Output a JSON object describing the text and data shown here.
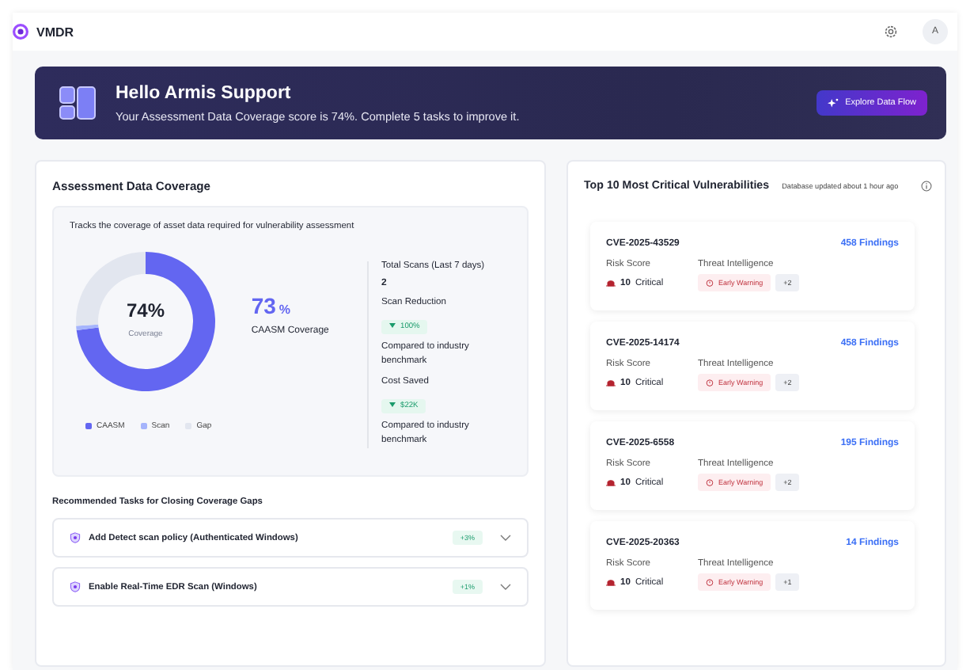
{
  "app": {
    "title": "VMDR",
    "avatar": "A"
  },
  "banner": {
    "heading": "Hello Armis Support",
    "text": "Your Assessment Data Coverage score is 74%. Complete 5 tasks to improve it.",
    "button": "Explore Data Flow"
  },
  "coverage": {
    "title": "Assessment Data Coverage",
    "description": "Tracks the coverage of asset data required for vulnerability assessment",
    "center_value": "74%",
    "center_label": "Coverage",
    "caasm_value": "73",
    "caasm_unit": "%",
    "caasm_label": "CAASM Coverage",
    "chart_data": {
      "type": "donut",
      "categories": [
        "CAASM",
        "Scan",
        "Gap"
      ],
      "series": [
        {
          "values": [
            73,
            1,
            26
          ]
        }
      ],
      "colors": [
        "#6366f1",
        "#a5b4fc",
        "#e2e6ef"
      ]
    },
    "stats": [
      {
        "label": "Total Scans (Last 7 days)",
        "value": "2"
      },
      {
        "label": "Scan Reduction",
        "badge": "100%",
        "note": "Compared to industry benchmark"
      },
      {
        "label": "Cost Saved",
        "badge": "$22K",
        "note": "Compared to industry benchmark"
      }
    ],
    "tasks_title": "Recommended Tasks for Closing Coverage Gaps",
    "tasks": [
      {
        "label": "Add Detect scan policy (Authenticated Windows)",
        "gain": "+3%",
        "expanded": false
      },
      {
        "label": "Enable Real-Time EDR Scan (Windows)",
        "gain": "+1%",
        "expanded": false
      }
    ]
  },
  "vulnerabilities": {
    "title": "Top 10 Most Critical Vulnerabilities",
    "updated": "Database updated about 1 hour ago",
    "items": [
      {
        "id": "CVE-2025-43529",
        "findings": "458 Findings",
        "risk_label": "Risk Score",
        "score": "10",
        "severity": "Critical",
        "intel_label": "Threat Intelligence",
        "tag": "Early Warning",
        "more": "+2"
      },
      {
        "id": "CVE-2025-14174",
        "findings": "458 Findings",
        "risk_label": "Risk Score",
        "score": "10",
        "severity": "Critical",
        "intel_label": "Threat Intelligence",
        "tag": "Early Warning",
        "more": "+2"
      },
      {
        "id": "CVE-2025-6558",
        "findings": "195 Findings",
        "risk_label": "Risk Score",
        "score": "10",
        "severity": "Critical",
        "intel_label": "Threat Intelligence",
        "tag": "Early Warning",
        "more": "+2"
      },
      {
        "id": "CVE-2025-20363",
        "findings": "14 Findings",
        "risk_label": "Risk Score",
        "score": "10",
        "severity": "Critical",
        "intel_label": "Threat Intelligence",
        "tag": "Early Warning",
        "more": "+1"
      }
    ]
  }
}
